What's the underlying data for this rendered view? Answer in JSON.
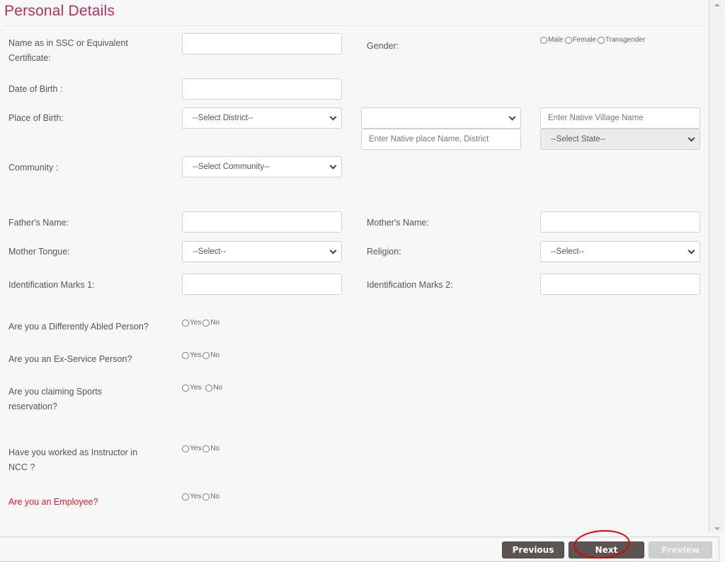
{
  "page": {
    "title": "Personal Details",
    "colors": {
      "title": "#b03060",
      "required_label": "#e41b2a",
      "button": "#5b5453"
    }
  },
  "form": {
    "name_label": "Name as in SSC or Equivalent Certificate:",
    "name_value": "",
    "gender_label": "Gender:",
    "gender_options": [
      "Male",
      "Female",
      "Transgender"
    ],
    "dob_label": "Date of Birth :",
    "dob_value": "",
    "pob_label": "Place of Birth:",
    "pob_district_select": "--Select District--",
    "pob_second_select": "",
    "native_village_placeholder": "Enter Native Village Name",
    "native_place_placeholder": "Enter Native place Name, District",
    "state_select": "--Select State--",
    "community_label": "Community :",
    "community_select": "--Select Community--",
    "father_label": "Father's Name:",
    "father_value": "",
    "mother_label": "Mother's Name:",
    "mother_value": "",
    "tongue_label": "Mother Tongue:",
    "tongue_select": "--Select--",
    "religion_label": "Religion:",
    "religion_select": "--Select--",
    "id_mark1_label": "Identification Marks 1:",
    "id_mark1_value": "",
    "id_mark2_label": "Identification Marks 2:",
    "id_mark2_value": "",
    "questions": [
      {
        "label": "Are you a Differently Abled Person?",
        "options": [
          "Yes",
          "No"
        ]
      },
      {
        "label": "Are you an Ex-Service Person?",
        "options": [
          "Yes",
          "No"
        ]
      },
      {
        "label": "Are you claiming Sports reservation?",
        "options": [
          "Yes",
          "No"
        ]
      },
      {
        "label": "Have you worked as Instructor in NCC ?",
        "options": [
          "Yes",
          "No"
        ]
      },
      {
        "label": "Are you an Employee?",
        "options": [
          "Yes",
          "No"
        ]
      }
    ]
  },
  "footer": {
    "previous_label": "Previous",
    "next_label": "Next",
    "preview_label": "Preview"
  }
}
